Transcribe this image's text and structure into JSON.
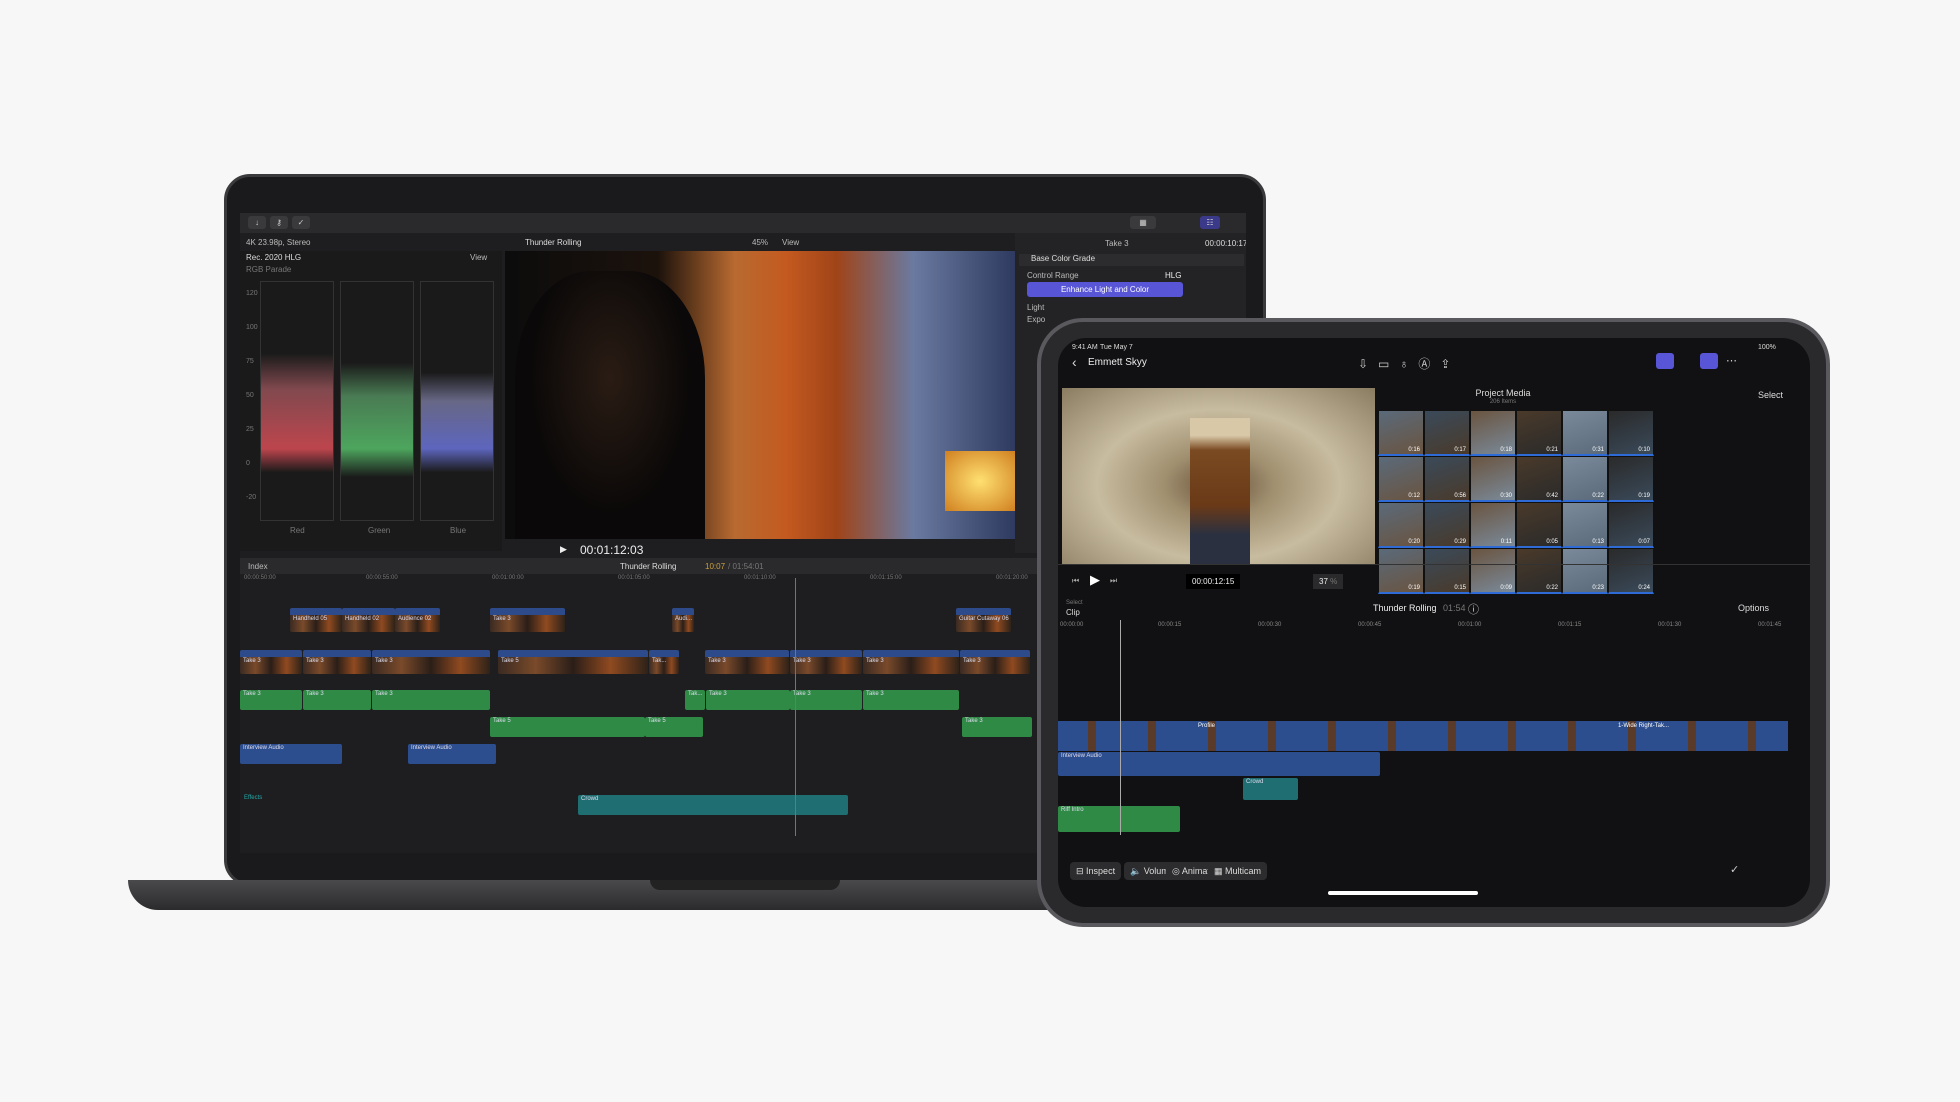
{
  "mac": {
    "toolbar": {
      "icons": [
        "import-icon",
        "keyword-icon",
        "checkmark-icon"
      ]
    },
    "info": {
      "format": "4K 23.98p, Stereo",
      "project": "Thunder Rolling",
      "zoom": "45%",
      "view": "View"
    },
    "scopes": {
      "color_space": "Rec. 2020 HLG",
      "view": "View",
      "type": "RGB Parade",
      "y_ticks": [
        "120",
        "100",
        "75",
        "50",
        "25",
        "0",
        "-20"
      ],
      "channels": [
        "Red",
        "Green",
        "Blue"
      ]
    },
    "viewer": {
      "timecode": "00:01:12:03"
    },
    "inspector": {
      "clip": "Take 3",
      "timecode": "00:00:10:17",
      "effect": "Base Color Grade",
      "control_range_label": "Control Range",
      "control_range_value": "HLG",
      "enhance_button": "Enhance Light and Color",
      "light": "Light",
      "exposure": "Expo"
    },
    "timeline": {
      "index": "Index",
      "project": "Thunder Rolling",
      "position": "10:07",
      "duration": "/ 01:54:01",
      "ruler": [
        "00:00:50:00",
        "00:00:55:00",
        "00:01:00:00",
        "00:01:05:00",
        "00:01:10:00",
        "00:01:15:00",
        "00:01:20:00"
      ],
      "connected": [
        "Handheld 05",
        "Handheld 02",
        "Audience 02",
        "Take 3",
        "Audi...",
        "Guitar Cutaway 06"
      ],
      "primary": [
        "Take 3",
        "Take 3",
        "Take 3",
        "Take 5",
        "Tak...",
        "Take 3",
        "Take 3",
        "Take 3",
        "Take 3"
      ],
      "audio1": [
        "Take 3",
        "Take 3",
        "Take 3",
        "Tak...",
        "Take 3",
        "Take 3",
        "Take 3"
      ],
      "audio2": [
        "Take 5",
        "Take 5",
        "Take 3"
      ],
      "interview": [
        "Interview Audio",
        "Interview Audio"
      ],
      "effects": "Effects",
      "crowd": "Crowd"
    }
  },
  "ipad": {
    "status": {
      "time": "9:41 AM",
      "date": "Tue May 7",
      "battery": "100%"
    },
    "nav": {
      "title": "Emmett Skyy"
    },
    "browser": {
      "title": "Project Media",
      "count": "206 Items",
      "select": "Select",
      "durations": [
        "0:16",
        "0:17",
        "0:18",
        "0:21",
        "0:31",
        "0:10",
        "0:12",
        "0:56",
        "0:30",
        "0:42",
        "0:22",
        "0:19",
        "0:20",
        "0:29",
        "0:11",
        "0:05",
        "0:13",
        "0:07",
        "0:19",
        "0:15",
        "0:09",
        "0:22",
        "0:23",
        "0:24"
      ]
    },
    "viewer": {
      "timecode": "00:00:12:15",
      "zoom": "37",
      "zoom_unit": "%"
    },
    "timeline": {
      "select_label": "Select",
      "select_value": "Clip",
      "project": "Thunder Rolling",
      "duration": "01:54",
      "options": "Options",
      "ruler": [
        "00:00:00",
        "00:00:15",
        "00:00:30",
        "00:00:45",
        "00:01:00",
        "00:01:15",
        "00:01:30",
        "00:01:45"
      ],
      "clips": {
        "profile": "Profile",
        "wide": "1-Wide Right-Tak...",
        "interview": "Interview Audio",
        "crowd": "Crowd",
        "riff": "Riff Intro"
      }
    },
    "toolbar": {
      "inspect": "Inspect",
      "volume": "Volume",
      "animate": "Animate",
      "multicam": "Multicam"
    }
  },
  "colors": {
    "accent": "#5856d6",
    "playhead": "#e0483a",
    "audio": "#2f8a45",
    "connected": "#2d4e8e"
  }
}
